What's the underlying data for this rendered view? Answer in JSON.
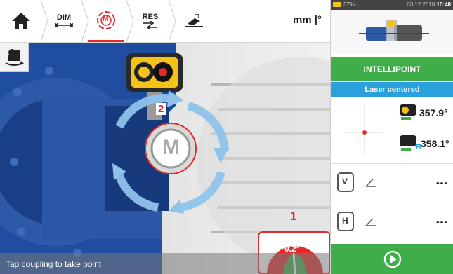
{
  "toolbar": {
    "dim_label": "DIM",
    "res_label": "RES",
    "measure_badge": "M",
    "units": "mm |°"
  },
  "scene": {
    "step_rotate": "2",
    "step_gauge": "1",
    "motor_label": "M",
    "gauge_value": "0.2°",
    "status_text": "Tap coupling to take point"
  },
  "panel": {
    "battery": "37%",
    "date": "03.12.2018",
    "time": "10:48",
    "intellipoint_label": "INTELLIPOINT",
    "laser_status": "Laser centered",
    "sensor_angle": "357.9°",
    "transducer_angle": "358.1°",
    "vertical_badge": "V",
    "horizontal_badge": "H",
    "vertical_value": "---",
    "horizontal_value": "---"
  },
  "colors": {
    "accent_red": "#e32b2b",
    "green": "#3fae49",
    "blue_status": "#2aa1dc",
    "machine_blue": "#2c5aa8"
  },
  "icons": [
    "home-icon",
    "dim-icon",
    "measure-icon",
    "res-icon",
    "machine-view-icon",
    "camera-rotate-icon",
    "play-icon",
    "wifi-icon",
    "angle-icon",
    "coupling-icon"
  ]
}
